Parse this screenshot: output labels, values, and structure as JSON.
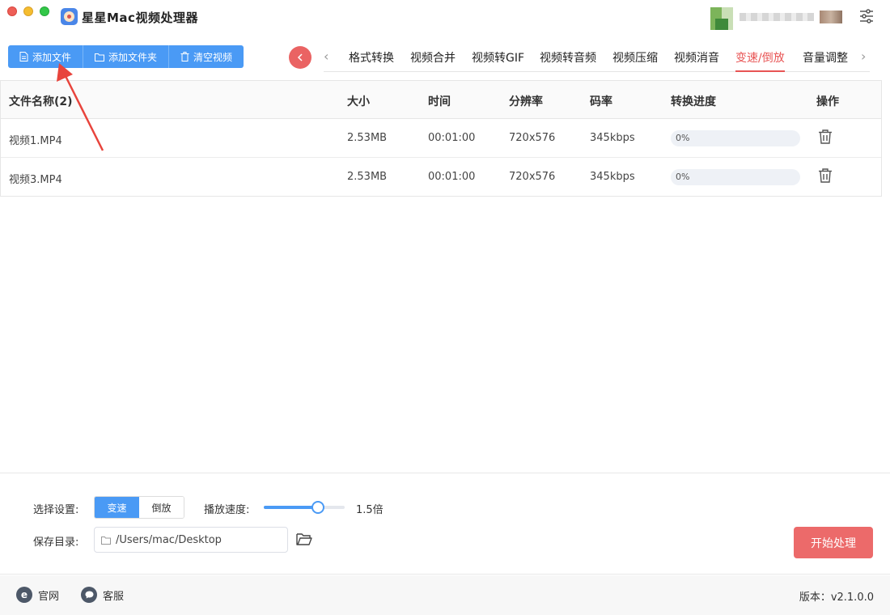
{
  "app": {
    "title": "星星Mac视频处理器"
  },
  "toolbar": {
    "add_file": "添加文件",
    "add_folder": "添加文件夹",
    "clear": "清空视频"
  },
  "tabs": [
    {
      "label": "格式转换",
      "active": false
    },
    {
      "label": "视频合并",
      "active": false
    },
    {
      "label": "视频转GIF",
      "active": false
    },
    {
      "label": "视频转音频",
      "active": false
    },
    {
      "label": "视频压缩",
      "active": false
    },
    {
      "label": "视频消音",
      "active": false
    },
    {
      "label": "变速/倒放",
      "active": true
    },
    {
      "label": "音量调整",
      "active": false
    }
  ],
  "table": {
    "headers": {
      "name": "文件名称(2)",
      "size": "大小",
      "time": "时间",
      "resolution": "分辨率",
      "bitrate": "码率",
      "progress": "转换进度",
      "action": "操作"
    },
    "rows": [
      {
        "name": "视频1.MP4",
        "size": "2.53MB",
        "time": "00:01:00",
        "resolution": "720x576",
        "bitrate": "345kbps",
        "progress": "0%",
        "progress_value": 0
      },
      {
        "name": "视频3.MP4",
        "size": "2.53MB",
        "time": "00:01:00",
        "resolution": "720x576",
        "bitrate": "345kbps",
        "progress": "0%",
        "progress_value": 0
      }
    ]
  },
  "settings": {
    "mode_label": "选择设置:",
    "mode_options": [
      "变速",
      "倒放"
    ],
    "mode_selected": "变速",
    "speed_label": "播放速度:",
    "speed_value": "1.5倍",
    "speed_fraction": 0.67,
    "save_label": "保存目录:",
    "save_path": "/Users/mac/Desktop",
    "start_button": "开始处理"
  },
  "footer": {
    "website": "官网",
    "support": "客服",
    "version": "版本：v2.1.0.0"
  },
  "colors": {
    "primary": "#4a9af5",
    "accent": "#e85454",
    "start_button": "#ec6a6a"
  }
}
